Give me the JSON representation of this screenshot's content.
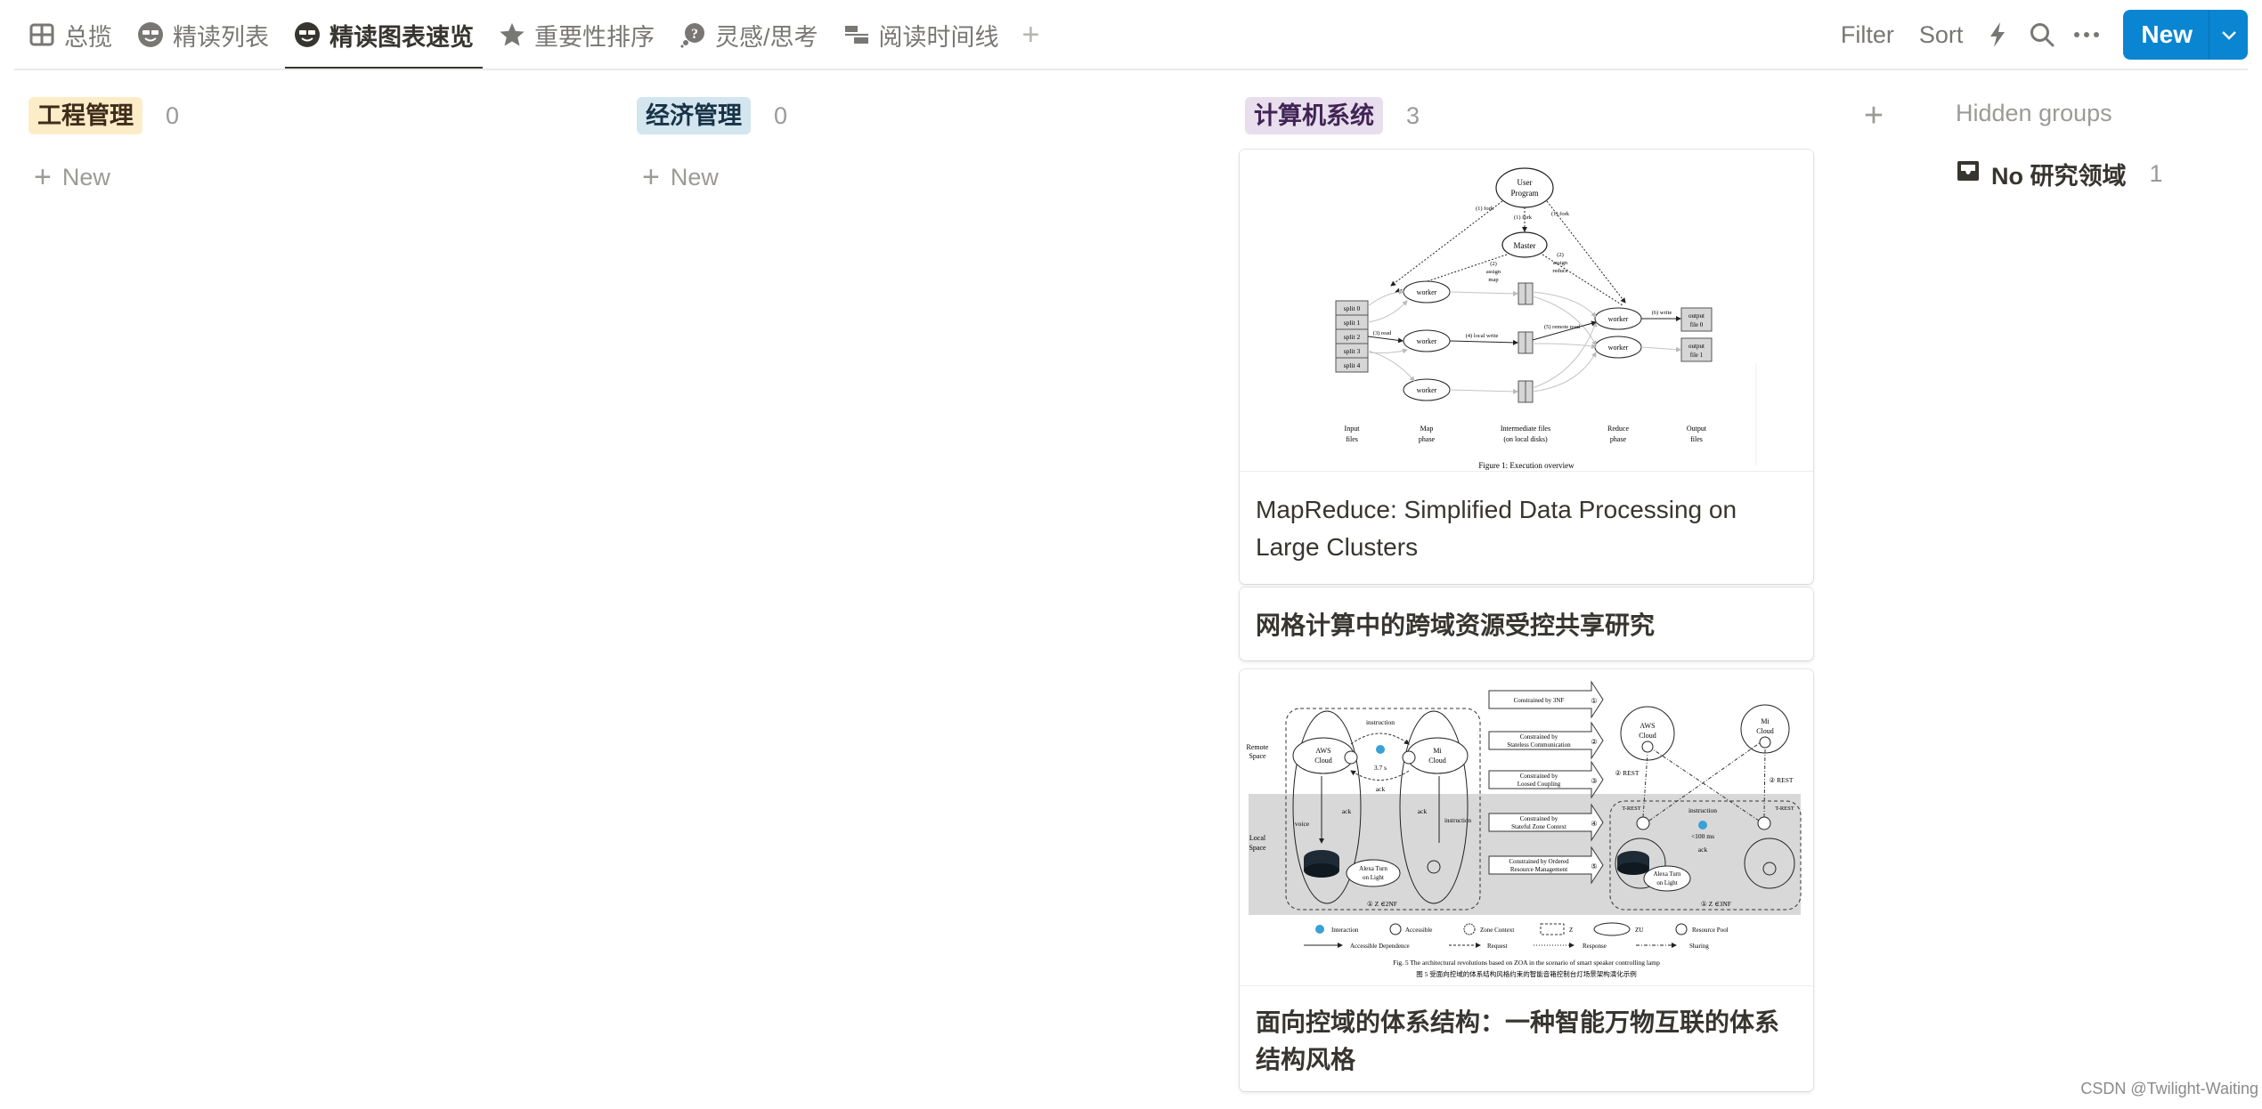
{
  "tabs": [
    {
      "label": "总揽",
      "icon": "table-icon",
      "active": false
    },
    {
      "label": "精读列表",
      "icon": "glasses-face-icon",
      "active": false
    },
    {
      "label": "精读图表速览",
      "icon": "glasses-face-icon",
      "active": true
    },
    {
      "label": "重要性排序",
      "icon": "star-icon",
      "active": false
    },
    {
      "label": "灵感/思考",
      "icon": "question-bubble-icon",
      "active": false
    },
    {
      "label": "阅读时间线",
      "icon": "timeline-icon",
      "active": false
    }
  ],
  "tab_add_label": "+",
  "toolbar": {
    "filter_label": "Filter",
    "sort_label": "Sort",
    "new_label": "New",
    "accent_color": "#0a85d1"
  },
  "groups": [
    {
      "label": "工程管理",
      "count": "0",
      "tag_bg": "#fdecc8",
      "tag_fg": "#402c1b",
      "new_label": "New"
    },
    {
      "label": "经济管理",
      "count": "0",
      "tag_bg": "#d3e5ef",
      "tag_fg": "#183347",
      "new_label": "New"
    },
    {
      "label": "计算机系统",
      "count": "3",
      "tag_bg": "#e8deee",
      "tag_fg": "#412454"
    }
  ],
  "cards": [
    {
      "title": "MapReduce: Simplified Data Processing on Large Clusters",
      "cover": {
        "caption": "Figure 1: Execution overview",
        "user_program": [
          "User",
          "Program"
        ],
        "master": "Master",
        "worker": "worker",
        "splits": [
          "split 0",
          "split 1",
          "split 2",
          "split 3",
          "split 4"
        ],
        "outputs": [
          [
            "output",
            "file 0"
          ],
          [
            "output",
            "file 1"
          ]
        ],
        "edge_labels": {
          "fork": "(1) fork",
          "assign_map": [
            "(2)",
            "assign",
            "map"
          ],
          "assign_reduce": [
            "(2)",
            "assign",
            "reduce"
          ],
          "read": "(3) read",
          "local_write": "(4) local write",
          "remote_read": "(5) remote read",
          "write": "(6) write"
        },
        "phases": [
          [
            "Input",
            "files"
          ],
          [
            "Map",
            "phase"
          ],
          [
            "Intermediate files",
            "(on local disks)"
          ],
          [
            "Reduce",
            "phase"
          ],
          [
            "Output",
            "files"
          ]
        ]
      }
    },
    {
      "title": "网格计算中的跨域资源受控共享研究"
    },
    {
      "title": "面向控域的体系结构：一种智能万物互联的体系结构风格",
      "cover": {
        "caption_en": "Fig. 5   The architectural revolutions based on ZOA in the scenario of smart speaker controlling lamp",
        "caption_zh": "图 5   受面向控域的体系结构风格约束的智能音箱控制台灯场景架构演化示例",
        "remote_space": [
          "Remote",
          "Space"
        ],
        "local_space": [
          "Local",
          "Space"
        ],
        "aws_cloud": [
          "AWS",
          "Cloud"
        ],
        "mi_cloud": [
          "Mi",
          "Cloud"
        ],
        "instruction": "instruction",
        "ack": "ack",
        "voice": "voice",
        "latency_before": "3.7 s",
        "latency_after": "<100 ms",
        "alexa": [
          "Alexa Turn",
          "on Light"
        ],
        "zone_before": "① Z ∈2NF",
        "zone_after": "① Z ∈3NF",
        "rest": "② REST",
        "t_rest": "T-REST",
        "constraints": [
          [
            "Constrained by 3NF"
          ],
          [
            "Constrained by",
            "Stateless Communication"
          ],
          [
            "Constrained by",
            "Loosed Coupling"
          ],
          [
            "Constrained by",
            "Stateful Zone Context"
          ],
          [
            "Constrained by Ordered",
            "Resource Management"
          ]
        ],
        "constraint_nums": [
          "①",
          "②",
          "③",
          "④",
          "⑤"
        ],
        "legend": [
          "Interaction",
          "Accessible",
          "Zone Context",
          "Z",
          "ZU",
          "Resource Pool"
        ],
        "legend_lines": [
          "Accessible Dependence",
          "Request",
          "Response",
          "Sharing"
        ]
      }
    }
  ],
  "hidden": {
    "title": "Hidden groups",
    "items": [
      {
        "label": "No 研究领域",
        "count": "1"
      }
    ]
  },
  "watermark": "CSDN @Twilight-Waiting"
}
